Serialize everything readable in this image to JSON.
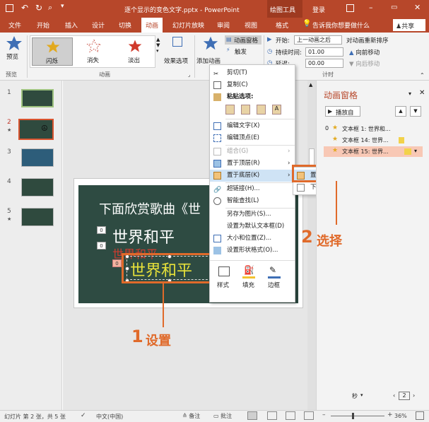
{
  "titlebar": {
    "title": "逐个显示的变色文字.pptx - PowerPoint",
    "context_tab": "绘图工具",
    "login": "登录",
    "restore_glyph": "▭"
  },
  "tabs": [
    "文件",
    "开始",
    "插入",
    "设计",
    "切换",
    "动画",
    "幻灯片放映",
    "审阅",
    "视图",
    "格式"
  ],
  "tell_me": "告诉我你想要做什么",
  "share": "共享",
  "ribbon": {
    "preview": "预览",
    "preview_group": "预览",
    "effects": [
      "闪烁",
      "消失",
      "淡出"
    ],
    "effect_options": "效果选项",
    "animation_group": "动画",
    "add_animation": "添加动画",
    "anim_pane": "动画窗格",
    "trigger": "触发",
    "start_label": "开始:",
    "start_value": "上一动画之后",
    "duration_label": "持续时间:",
    "duration_value": "01.00",
    "delay_label": "延迟:",
    "delay_value": "00.00",
    "reorder_title": "对动画重新排序",
    "move_earlier": "向前移动",
    "move_later": "向后移动",
    "timing_group": "计时"
  },
  "slides": [
    {
      "num": "1",
      "mark": ""
    },
    {
      "num": "2",
      "mark": "★"
    },
    {
      "num": "3",
      "mark": ""
    },
    {
      "num": "4",
      "mark": ""
    },
    {
      "num": "5",
      "mark": "★"
    }
  ],
  "slide": {
    "heading": "下面欣赏歌曲《世",
    "text_white": "世界和平",
    "text_red": "世界和平",
    "text_yellow": "世界和平",
    "badge_a": "0",
    "badge_b": "0",
    "badge_c": "0"
  },
  "context_menu": {
    "items": [
      {
        "label": "剪切(T)",
        "disabled": false
      },
      {
        "label": "复制(C)",
        "disabled": false
      },
      {
        "label": "粘贴选项:",
        "disabled": false
      },
      {
        "label": "编辑文字(X)",
        "disabled": false
      },
      {
        "label": "编辑顶点(E)",
        "disabled": false
      },
      {
        "label": "组合(G)",
        "disabled": true
      },
      {
        "label": "置于顶层(R)",
        "disabled": false
      },
      {
        "label": "置于底层(K)",
        "disabled": false
      },
      {
        "label": "超链接(H)...",
        "disabled": false
      },
      {
        "label": "智能查找(L)",
        "disabled": false
      },
      {
        "label": "另存为图片(S)...",
        "disabled": false
      },
      {
        "label": "设置为默认文本框(D)",
        "disabled": false
      },
      {
        "label": "大小和位置(Z)...",
        "disabled": false
      },
      {
        "label": "设置形状格式(O)...",
        "disabled": false
      }
    ],
    "mini": [
      "样式",
      "填充",
      "边框"
    ]
  },
  "submenu": {
    "items": [
      "置于底层(K)",
      "下移一层(B)"
    ]
  },
  "anim_pane": {
    "title": "动画窗格",
    "play": "播放自",
    "items": [
      {
        "num": "0",
        "label": "文本框 1: 世界和..."
      },
      {
        "num": "",
        "label": "文本框 14: 世界..."
      },
      {
        "num": "",
        "label": "文本框 15: 世界..."
      }
    ],
    "seconds": "秒",
    "page": "2"
  },
  "callouts": {
    "one_num": "1",
    "one_text": "设置",
    "two_num": "2",
    "two_text": "选择"
  },
  "status": {
    "slide_info": "幻灯片 第 2 张，共 5 张",
    "lang": "中文(中国)",
    "notes": "备注",
    "comments": "批注",
    "zoom": "36%"
  },
  "colors": {
    "brand": "#b7472a",
    "callout": "#e06a2a",
    "slide_bg": "#2e4b42",
    "highlight": "#f8c8b5"
  }
}
